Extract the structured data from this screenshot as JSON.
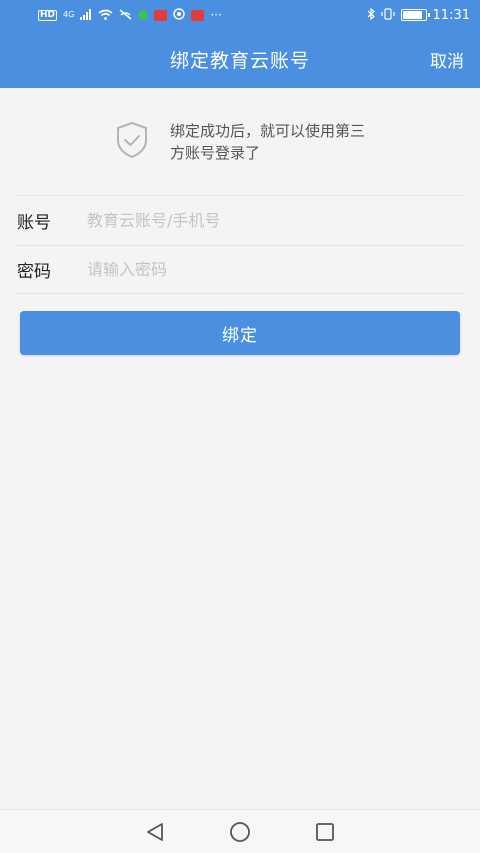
{
  "status_bar": {
    "left_icons": [
      "HD",
      "4G",
      "signal-icon",
      "wifi-icon",
      "no-mic-icon",
      "chat-icon",
      "mail-icon",
      "camera-icon",
      "app-icon",
      "more-icon"
    ],
    "hd_label": "HD",
    "network_label": "4G",
    "more_label": "···",
    "time": "11:31"
  },
  "header": {
    "title": "绑定教育云账号",
    "cancel_label": "取消"
  },
  "notice": {
    "text": "绑定成功后，就可以使用第三方账号登录了"
  },
  "form": {
    "account": {
      "label": "账号",
      "placeholder": "教育云账号/手机号",
      "value": ""
    },
    "password": {
      "label": "密码",
      "placeholder": "请输入密码",
      "value": ""
    }
  },
  "bind_button": {
    "label": "绑定"
  },
  "nav_bar": {
    "items": [
      "back-icon",
      "home-icon",
      "recents-icon"
    ]
  },
  "colors": {
    "primary": "#4a8fe0",
    "background": "#f4f4f4"
  }
}
